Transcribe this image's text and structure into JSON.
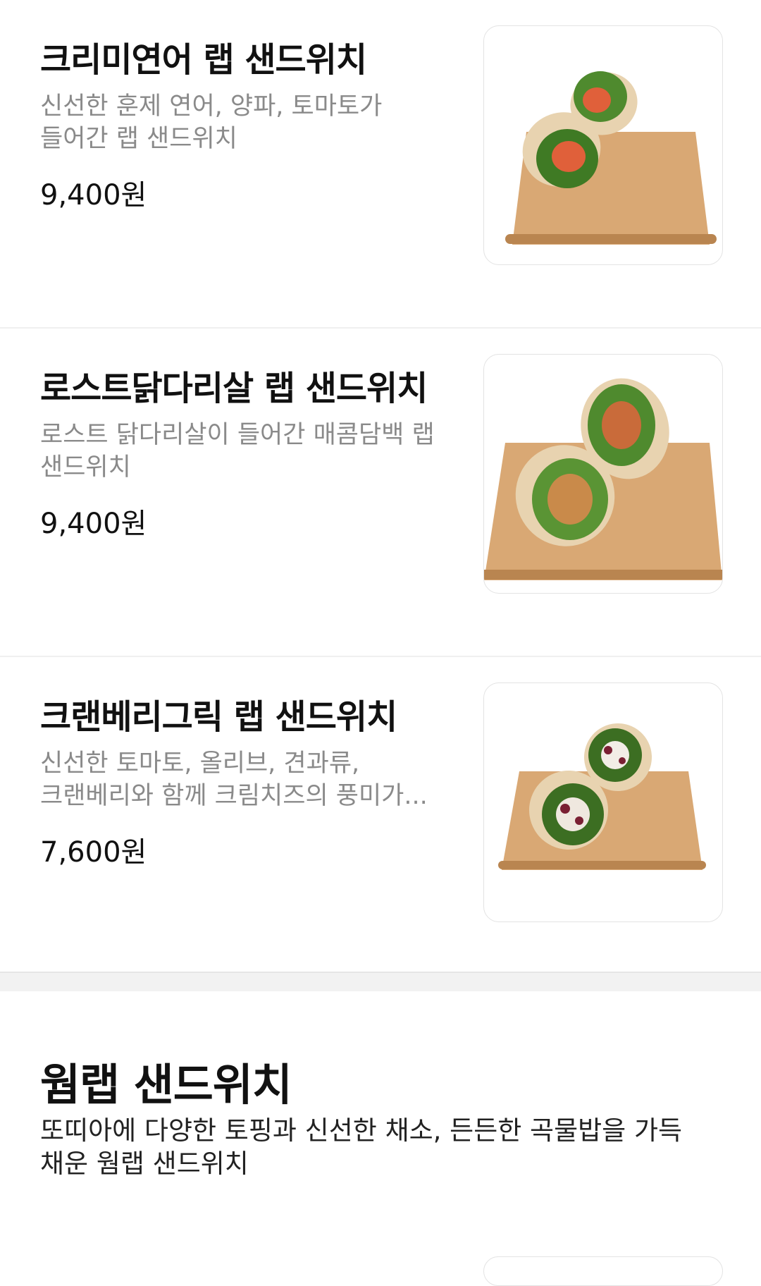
{
  "items": [
    {
      "name": "크리미연어 랩 샌드위치",
      "desc_lines": [
        "신선한 훈제 연어, 양파, 토마토가",
        "들어간 랩 샌드위치"
      ],
      "price": "9,400원",
      "image_icon": "salmon-wrap-image"
    },
    {
      "name": "로스트닭다리살 랩 샌드위치",
      "desc_lines": [
        "로스트 닭다리살이 들어간 매콤담백 랩",
        "샌드위치"
      ],
      "price": "9,400원",
      "image_icon": "chicken-wrap-image"
    },
    {
      "name": "크랜베리그릭 랩 샌드위치",
      "desc_lines": [
        "신선한 토마토, 올리브, 견과류,",
        "크랜베리와 함께 크림치즈의 풍미가..."
      ],
      "price": "7,600원",
      "image_icon": "cranberry-wrap-image"
    }
  ],
  "section": {
    "title": "웜랩 샌드위치",
    "desc_lines": [
      "또띠아에 다양한 토핑과 신선한 채소, 든든한 곡물밥을 가득",
      "채운 웜랩 샌드위치"
    ]
  },
  "colors": {
    "board": "#d9a874",
    "paper": "#e8d3b0",
    "lettuce": "#4f8a2e",
    "salmon": "#e0603a",
    "cranberry": "#7a2033"
  }
}
